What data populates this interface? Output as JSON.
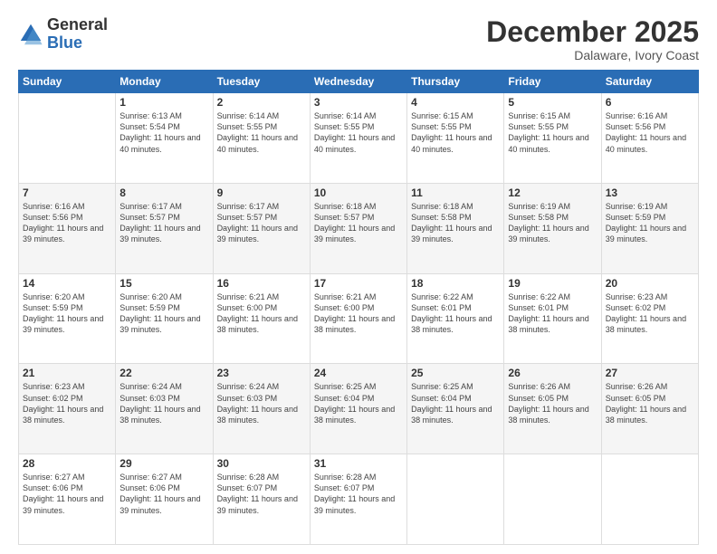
{
  "logo": {
    "general": "General",
    "blue": "Blue"
  },
  "title": "December 2025",
  "subtitle": "Dalaware, Ivory Coast",
  "days": [
    "Sunday",
    "Monday",
    "Tuesday",
    "Wednesday",
    "Thursday",
    "Friday",
    "Saturday"
  ],
  "weeks": [
    [
      {
        "day": "",
        "sunrise": "",
        "sunset": "",
        "daylight": ""
      },
      {
        "day": "1",
        "sunrise": "Sunrise: 6:13 AM",
        "sunset": "Sunset: 5:54 PM",
        "daylight": "Daylight: 11 hours and 40 minutes."
      },
      {
        "day": "2",
        "sunrise": "Sunrise: 6:14 AM",
        "sunset": "Sunset: 5:55 PM",
        "daylight": "Daylight: 11 hours and 40 minutes."
      },
      {
        "day": "3",
        "sunrise": "Sunrise: 6:14 AM",
        "sunset": "Sunset: 5:55 PM",
        "daylight": "Daylight: 11 hours and 40 minutes."
      },
      {
        "day": "4",
        "sunrise": "Sunrise: 6:15 AM",
        "sunset": "Sunset: 5:55 PM",
        "daylight": "Daylight: 11 hours and 40 minutes."
      },
      {
        "day": "5",
        "sunrise": "Sunrise: 6:15 AM",
        "sunset": "Sunset: 5:55 PM",
        "daylight": "Daylight: 11 hours and 40 minutes."
      },
      {
        "day": "6",
        "sunrise": "Sunrise: 6:16 AM",
        "sunset": "Sunset: 5:56 PM",
        "daylight": "Daylight: 11 hours and 40 minutes."
      }
    ],
    [
      {
        "day": "7",
        "sunrise": "Sunrise: 6:16 AM",
        "sunset": "Sunset: 5:56 PM",
        "daylight": "Daylight: 11 hours and 39 minutes."
      },
      {
        "day": "8",
        "sunrise": "Sunrise: 6:17 AM",
        "sunset": "Sunset: 5:57 PM",
        "daylight": "Daylight: 11 hours and 39 minutes."
      },
      {
        "day": "9",
        "sunrise": "Sunrise: 6:17 AM",
        "sunset": "Sunset: 5:57 PM",
        "daylight": "Daylight: 11 hours and 39 minutes."
      },
      {
        "day": "10",
        "sunrise": "Sunrise: 6:18 AM",
        "sunset": "Sunset: 5:57 PM",
        "daylight": "Daylight: 11 hours and 39 minutes."
      },
      {
        "day": "11",
        "sunrise": "Sunrise: 6:18 AM",
        "sunset": "Sunset: 5:58 PM",
        "daylight": "Daylight: 11 hours and 39 minutes."
      },
      {
        "day": "12",
        "sunrise": "Sunrise: 6:19 AM",
        "sunset": "Sunset: 5:58 PM",
        "daylight": "Daylight: 11 hours and 39 minutes."
      },
      {
        "day": "13",
        "sunrise": "Sunrise: 6:19 AM",
        "sunset": "Sunset: 5:59 PM",
        "daylight": "Daylight: 11 hours and 39 minutes."
      }
    ],
    [
      {
        "day": "14",
        "sunrise": "Sunrise: 6:20 AM",
        "sunset": "Sunset: 5:59 PM",
        "daylight": "Daylight: 11 hours and 39 minutes."
      },
      {
        "day": "15",
        "sunrise": "Sunrise: 6:20 AM",
        "sunset": "Sunset: 5:59 PM",
        "daylight": "Daylight: 11 hours and 39 minutes."
      },
      {
        "day": "16",
        "sunrise": "Sunrise: 6:21 AM",
        "sunset": "Sunset: 6:00 PM",
        "daylight": "Daylight: 11 hours and 38 minutes."
      },
      {
        "day": "17",
        "sunrise": "Sunrise: 6:21 AM",
        "sunset": "Sunset: 6:00 PM",
        "daylight": "Daylight: 11 hours and 38 minutes."
      },
      {
        "day": "18",
        "sunrise": "Sunrise: 6:22 AM",
        "sunset": "Sunset: 6:01 PM",
        "daylight": "Daylight: 11 hours and 38 minutes."
      },
      {
        "day": "19",
        "sunrise": "Sunrise: 6:22 AM",
        "sunset": "Sunset: 6:01 PM",
        "daylight": "Daylight: 11 hours and 38 minutes."
      },
      {
        "day": "20",
        "sunrise": "Sunrise: 6:23 AM",
        "sunset": "Sunset: 6:02 PM",
        "daylight": "Daylight: 11 hours and 38 minutes."
      }
    ],
    [
      {
        "day": "21",
        "sunrise": "Sunrise: 6:23 AM",
        "sunset": "Sunset: 6:02 PM",
        "daylight": "Daylight: 11 hours and 38 minutes."
      },
      {
        "day": "22",
        "sunrise": "Sunrise: 6:24 AM",
        "sunset": "Sunset: 6:03 PM",
        "daylight": "Daylight: 11 hours and 38 minutes."
      },
      {
        "day": "23",
        "sunrise": "Sunrise: 6:24 AM",
        "sunset": "Sunset: 6:03 PM",
        "daylight": "Daylight: 11 hours and 38 minutes."
      },
      {
        "day": "24",
        "sunrise": "Sunrise: 6:25 AM",
        "sunset": "Sunset: 6:04 PM",
        "daylight": "Daylight: 11 hours and 38 minutes."
      },
      {
        "day": "25",
        "sunrise": "Sunrise: 6:25 AM",
        "sunset": "Sunset: 6:04 PM",
        "daylight": "Daylight: 11 hours and 38 minutes."
      },
      {
        "day": "26",
        "sunrise": "Sunrise: 6:26 AM",
        "sunset": "Sunset: 6:05 PM",
        "daylight": "Daylight: 11 hours and 38 minutes."
      },
      {
        "day": "27",
        "sunrise": "Sunrise: 6:26 AM",
        "sunset": "Sunset: 6:05 PM",
        "daylight": "Daylight: 11 hours and 38 minutes."
      }
    ],
    [
      {
        "day": "28",
        "sunrise": "Sunrise: 6:27 AM",
        "sunset": "Sunset: 6:06 PM",
        "daylight": "Daylight: 11 hours and 39 minutes."
      },
      {
        "day": "29",
        "sunrise": "Sunrise: 6:27 AM",
        "sunset": "Sunset: 6:06 PM",
        "daylight": "Daylight: 11 hours and 39 minutes."
      },
      {
        "day": "30",
        "sunrise": "Sunrise: 6:28 AM",
        "sunset": "Sunset: 6:07 PM",
        "daylight": "Daylight: 11 hours and 39 minutes."
      },
      {
        "day": "31",
        "sunrise": "Sunrise: 6:28 AM",
        "sunset": "Sunset: 6:07 PM",
        "daylight": "Daylight: 11 hours and 39 minutes."
      },
      {
        "day": "",
        "sunrise": "",
        "sunset": "",
        "daylight": ""
      },
      {
        "day": "",
        "sunrise": "",
        "sunset": "",
        "daylight": ""
      },
      {
        "day": "",
        "sunrise": "",
        "sunset": "",
        "daylight": ""
      }
    ]
  ]
}
